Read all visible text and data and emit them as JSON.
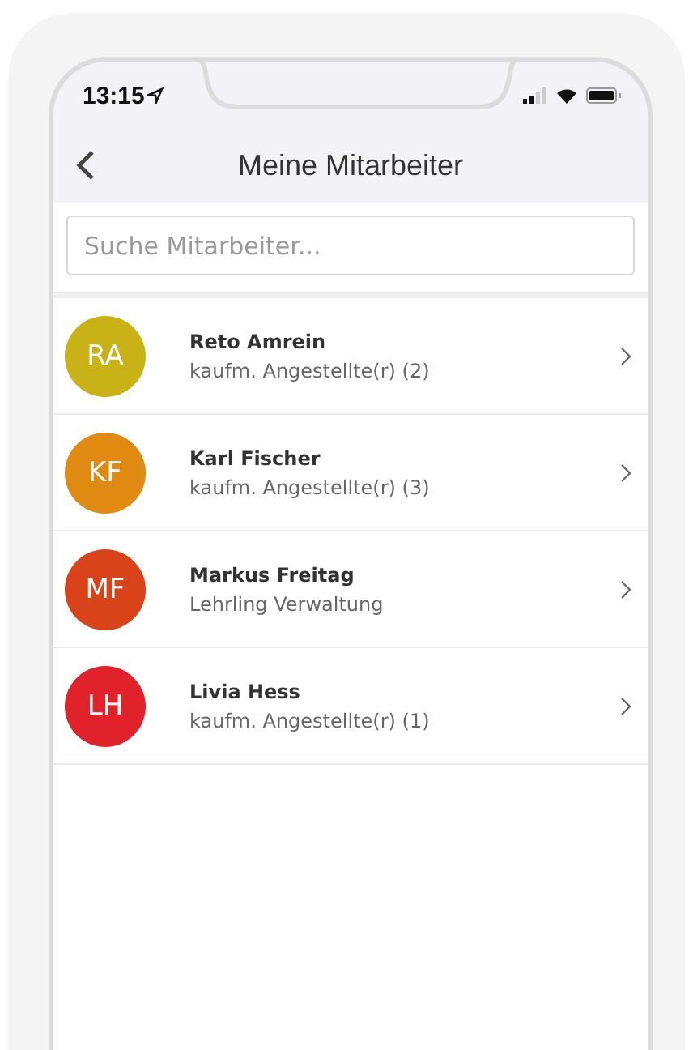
{
  "status_bar": {
    "time": "13:15"
  },
  "nav": {
    "title": "Meine Mitarbeiter"
  },
  "search": {
    "placeholder": "Suche Mitarbeiter..."
  },
  "employees": [
    {
      "initials": "RA",
      "name": "Reto Amrein",
      "role": "kaufm. Angestellte(r) (2)",
      "color": "#c8b215"
    },
    {
      "initials": "KF",
      "name": "Karl Fischer",
      "role": "kaufm. Angestellte(r) (3)",
      "color": "#e08a12"
    },
    {
      "initials": "MF",
      "name": "Markus Freitag",
      "role": "Lehrling Verwaltung",
      "color": "#d9431a"
    },
    {
      "initials": "LH",
      "name": "Livia Hess",
      "role": "kaufm. Angestellte(r) (1)",
      "color": "#e0232a"
    }
  ]
}
